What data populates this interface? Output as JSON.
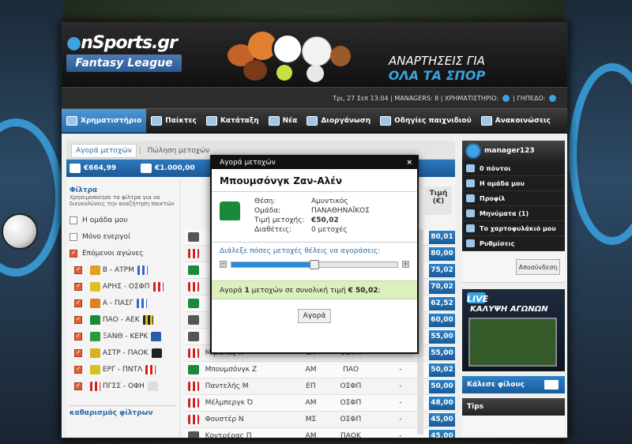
{
  "brand": {
    "logo_main": "nSports",
    "logo_domain": ".gr",
    "logo_sub": "Fantasy League"
  },
  "banner": {
    "line1": "ΑΝΑΡΤΗΣΕΙΣ ΓΙΑ",
    "line2": "ΟΛΑ ΤΑ ΣΠΟΡ"
  },
  "infobar": {
    "text": "Τρι, 27 Σεπ 13:04  | MANAGERS: 8 | ΧΡΗΜΑΤΙΣΤΗΡΙΟ:",
    "suffix": "| ΓΗΠΕΔΟ:"
  },
  "nav": [
    {
      "label": "Χρηματιστήριο",
      "active": true
    },
    {
      "label": "Παίκτες"
    },
    {
      "label": "Κατάταξη"
    },
    {
      "label": "Νέα"
    },
    {
      "label": "Διοργάνωση"
    },
    {
      "label": "Οδηγίες παιχνιδιού"
    },
    {
      "label": "Ανακοινώσεις"
    }
  ],
  "tabs": {
    "buy": "Αγορά μετοχών",
    "sell": "Πώληση μετοχών"
  },
  "money": {
    "balance": "€664,99",
    "value": "€1.000,00"
  },
  "filters": {
    "title": "Φίλτρα",
    "desc": "Χρησιμοποίησε τα φίλτρα για να διευκολύνεις την αναζήτηση παικτών",
    "my_team": "Η ομάδα μου",
    "only_active": "Μόνο ενεργοί",
    "next_matches": "Επόμενοι αγώνες",
    "matches": [
      "Β - ΑΤΡΜ",
      "ΑΡΗΣ - ΟΣΦΠ",
      "Α - ΠΑΣΓ",
      "ΠΑΟ - ΑΕΚ",
      "ΞΑΝΘ - ΚΕΡΚ",
      "ΑΣΤΡ - ΠΑΟΚ",
      "ΕΡΓ - ΠΝΤΛ",
      "ΠΓΣΣ - ΟΦΗ"
    ],
    "clear": "καθαρισμός φίλτρων"
  },
  "table": {
    "price_header": "Τιμή (€)",
    "rows": [
      {
        "name": "",
        "pos": "",
        "team": "",
        "other": "",
        "price": "80,01"
      },
      {
        "name": "",
        "pos": "",
        "team": "",
        "other": "",
        "price": "80,00"
      },
      {
        "name": "",
        "pos": "",
        "team": "",
        "other": "",
        "price": "75,02"
      },
      {
        "name": "",
        "pos": "",
        "team": "",
        "other": "",
        "price": "70,02"
      },
      {
        "name": "",
        "pos": "",
        "team": "",
        "other": "",
        "price": "62,52"
      },
      {
        "name": "",
        "pos": "",
        "team": "",
        "other": "",
        "price": "60,00"
      },
      {
        "name": "",
        "pos": "",
        "team": "",
        "other": "",
        "price": "55,00"
      },
      {
        "name": "Μιραλάς Κ",
        "pos": "ΕΠ",
        "team": "ΟΣΦΠ",
        "other": "-",
        "price": "55,00"
      },
      {
        "name": "Μπουμσόνγκ Ζ",
        "pos": "ΑΜ",
        "team": "ΠΑΟ",
        "other": "-",
        "price": "50,02"
      },
      {
        "name": "Παντελής Μ",
        "pos": "ΕΠ",
        "team": "ΟΣΦΠ",
        "other": "-",
        "price": "50,00"
      },
      {
        "name": "Μέλμπεργκ Ό",
        "pos": "ΑΜ",
        "team": "ΟΣΦΠ",
        "other": "-",
        "price": "48,00"
      },
      {
        "name": "Φουστέρ Ν",
        "pos": "ΜΣ",
        "team": "ΟΣΦΠ",
        "other": "-",
        "price": "45,00"
      },
      {
        "name": "Κοντρέρας Π",
        "pos": "ΑΜ",
        "team": "ΠΑΟΚ",
        "other": "-",
        "price": "45,00"
      }
    ]
  },
  "modal": {
    "title": "Αγορά μετοχών",
    "close": "×",
    "player": "Μπουμσόνγκ Ζαν-Αλέν",
    "pos_label": "Θέση:",
    "pos_value": "Αμυντικός",
    "team_label": "Ομάδα:",
    "team_value": "ΠΑΝΑΘΗΝΑΪΚΟΣ",
    "price_label": "Τιμή μετοχής:",
    "price_value": "€50,02",
    "avail_label": "Διαθέτεις:",
    "avail_value": "0 μετοχές",
    "slider_label": "Διάλεξε πόσες μετοχές θέλεις να αγοράσεις:",
    "slider_value": 0.5,
    "summary_prefix": "Αγορά ",
    "summary_qty": "1",
    "summary_mid": " μετοχών σε συνολική τιμή ",
    "summary_total": "€ 50,02",
    "summary_suffix": ";",
    "buy": "Αγορά"
  },
  "user": {
    "name": "manager123",
    "menu": [
      "0 πόντοι",
      "Η ομάδα μου",
      "Προφίλ",
      "Μηνύματα (1)",
      "Το χαρτοφυλάκιό μου",
      "Ρυθμίσεις"
    ],
    "logout": "Αποσύνδεση"
  },
  "live": {
    "l1": "LIVE",
    "l2": "ΚΑΛΥΨΗ ΑΓΩΝΩΝ"
  },
  "invite": "Κάλεσε φίλους",
  "tips": "Tips"
}
